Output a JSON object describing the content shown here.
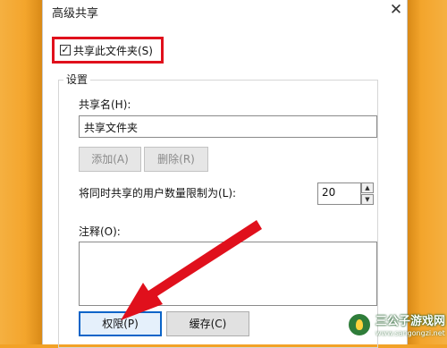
{
  "window": {
    "title": "高级共享",
    "close_glyph": "✕"
  },
  "share_folder": {
    "label": "共享此文件夹(S)",
    "checked": true,
    "check_glyph": "✓",
    "highlight_color": "#e0101c"
  },
  "settings": {
    "legend": "设置",
    "share_name_label": "共享名(H):",
    "share_name_value": "共享文件夹",
    "add_button": "添加(A)",
    "remove_button": "删除(R)",
    "limit_label": "将同时共享的用户数量限制为(L):",
    "limit_value": "20",
    "up_glyph": "▲",
    "down_glyph": "▼",
    "comment_label": "注释(O):",
    "comment_value": ""
  },
  "buttons": {
    "permissions": "权限(P)",
    "caching": "缓存(C)"
  },
  "annotation": {
    "arrow_color": "#e0101c"
  },
  "watermark": {
    "name": "三公子游戏网",
    "url": "www.sangongzi.net"
  },
  "colors": {
    "background": "#f2a227",
    "accent_blue": "#0a64c8"
  }
}
